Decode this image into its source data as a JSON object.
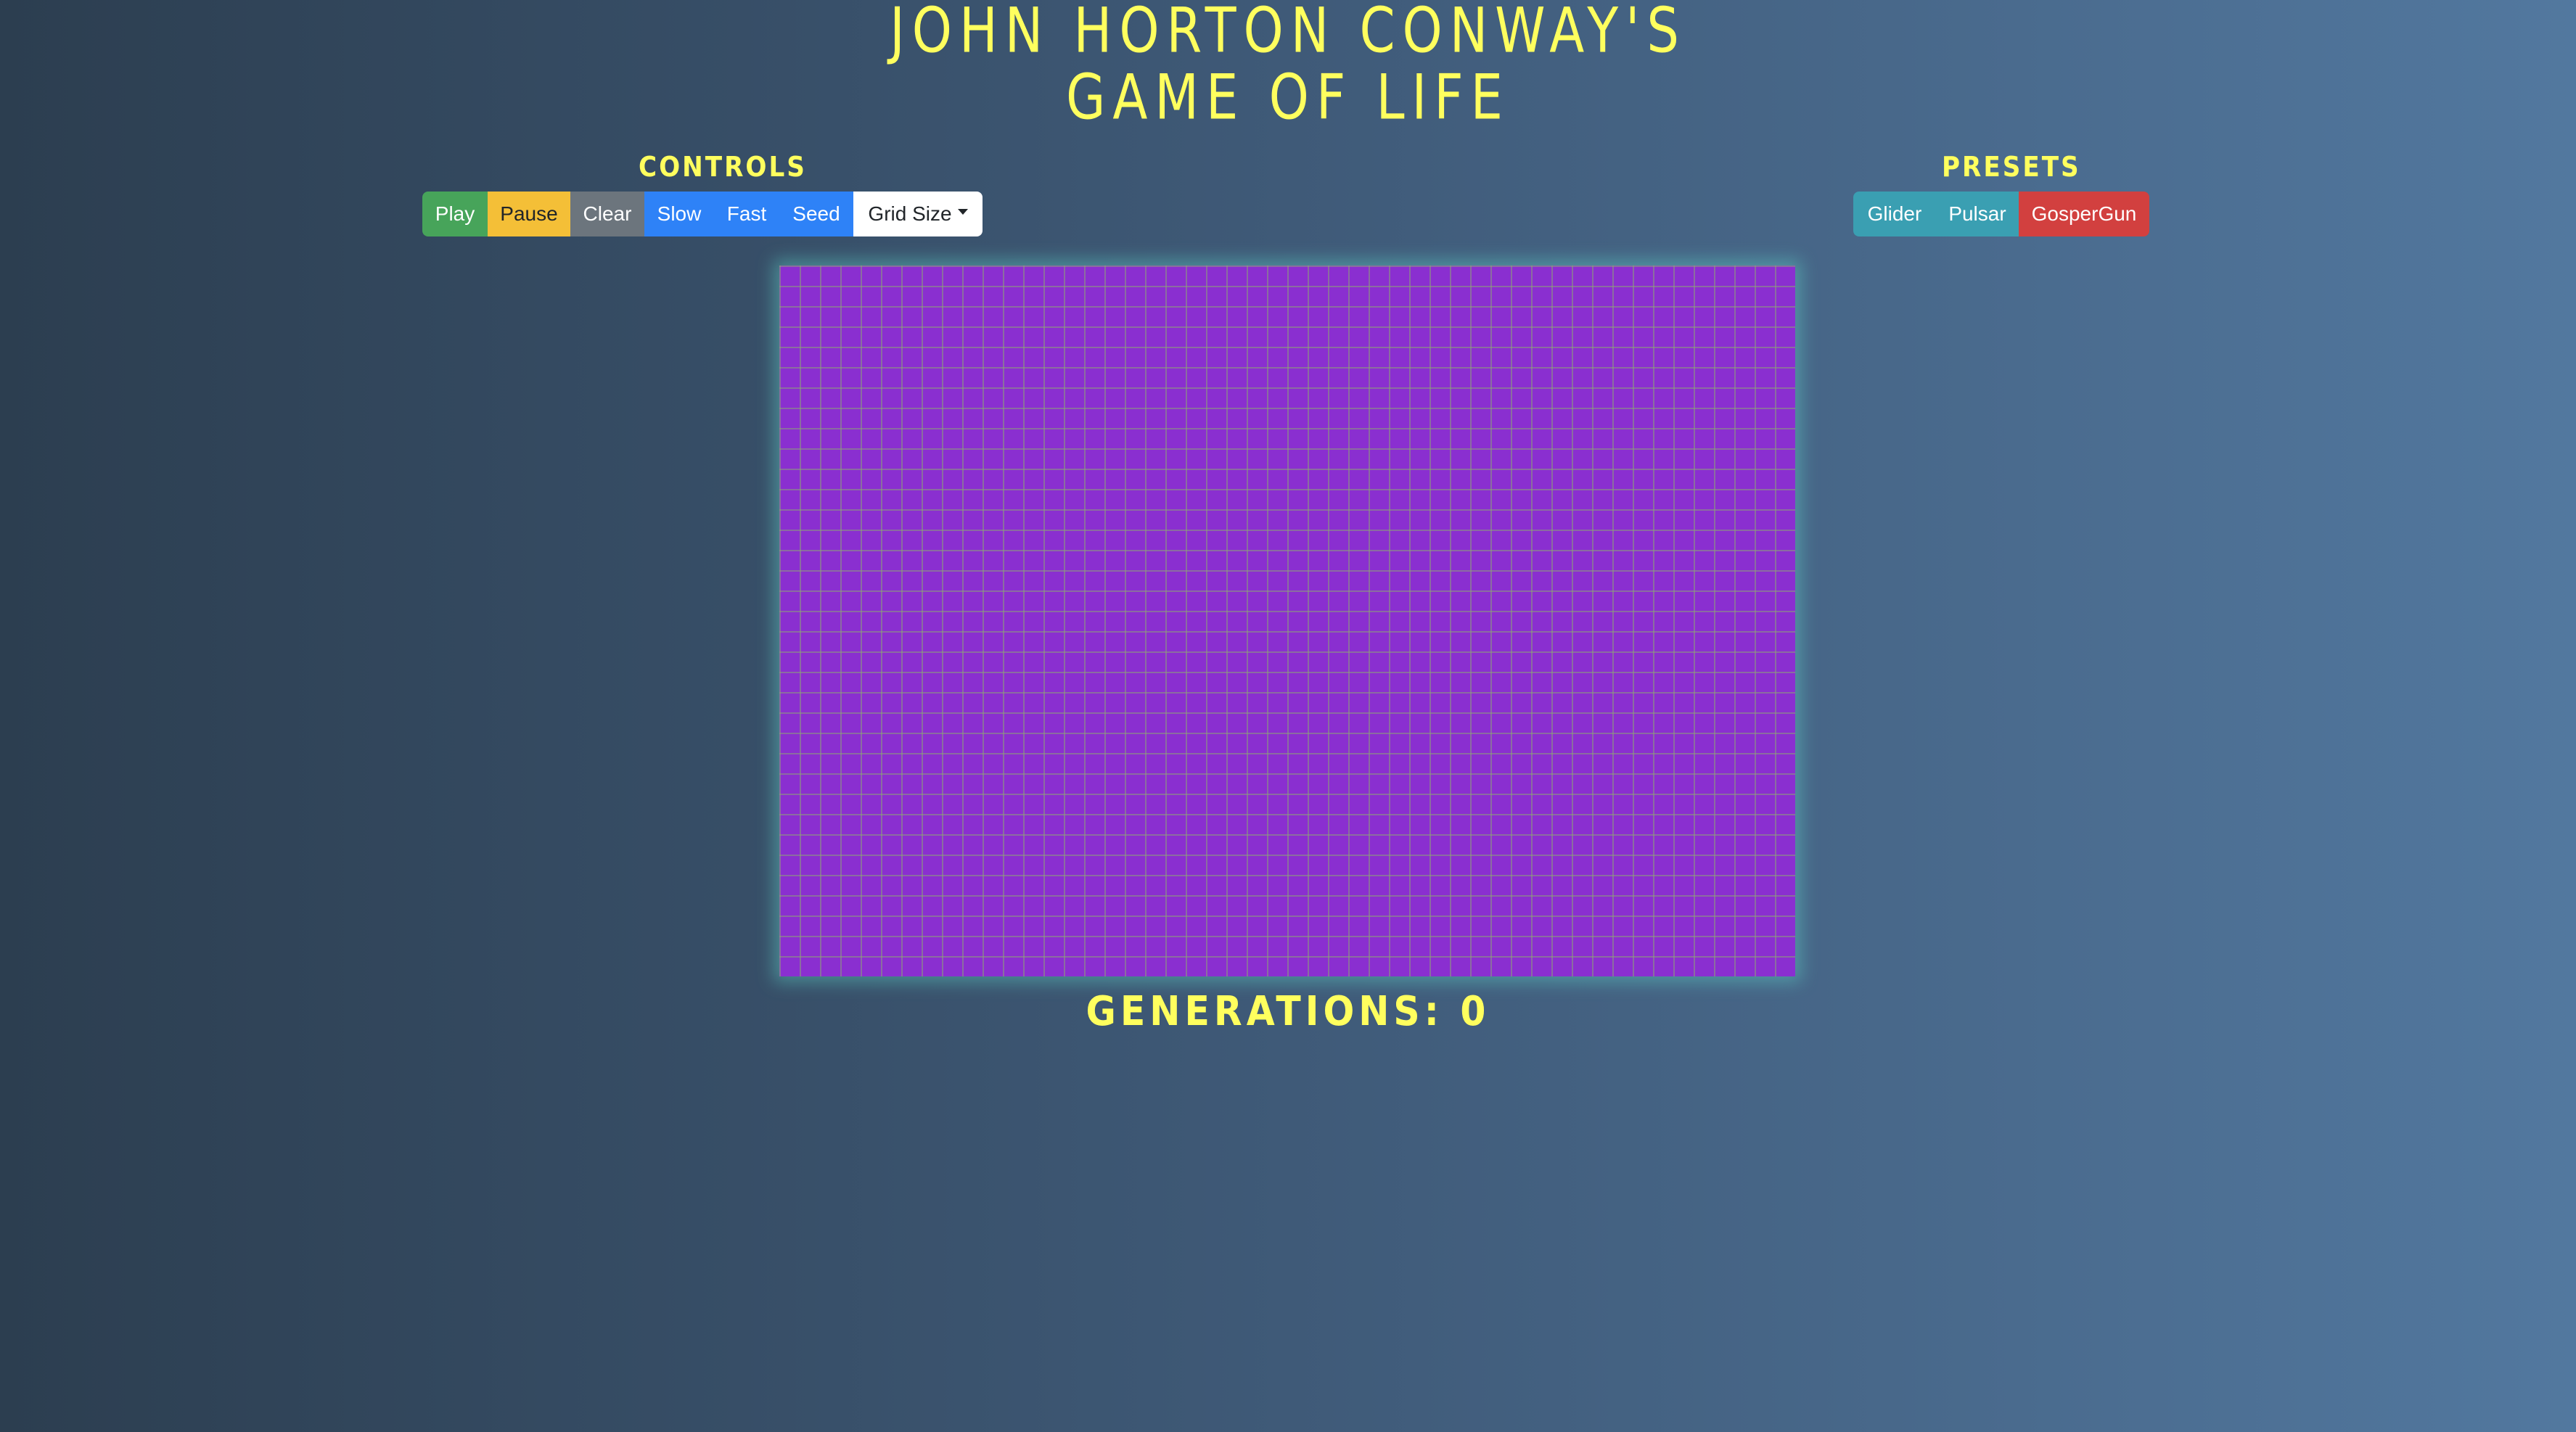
{
  "header": {
    "title_line1": "John Horton Conway's",
    "title_line2": "Game of Life"
  },
  "controls": {
    "heading": "Controls",
    "buttons": {
      "play": "Play",
      "pause": "Pause",
      "clear": "Clear",
      "slow": "Slow",
      "fast": "Fast",
      "seed": "Seed",
      "grid_size": "Grid Size"
    }
  },
  "presets": {
    "heading": "Presets",
    "buttons": {
      "glider": "Glider",
      "pulsar": "Pulsar",
      "gosper_gun": "GosperGun"
    }
  },
  "board": {
    "cell_color": "#8a2fd0",
    "alive_cells": 0
  },
  "footer": {
    "generations_label": "Generations:",
    "generations_value": "0"
  },
  "colors": {
    "accent_text": "#ffff5e",
    "play": "#47a45a",
    "pause": "#f4bf37",
    "clear": "#6c757d",
    "speed": "#2e82f7",
    "preset": "#3a9fb2",
    "gosper": "#d2403f"
  }
}
